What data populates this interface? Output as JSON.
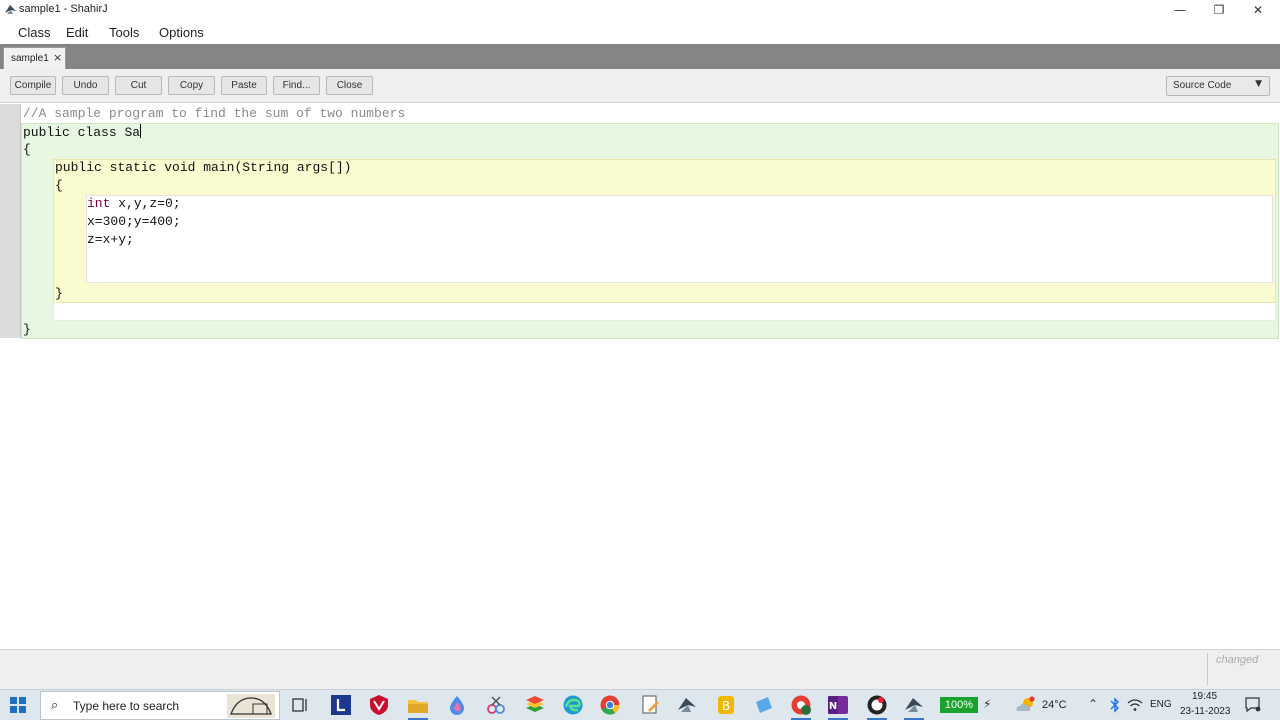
{
  "window": {
    "title": "sample1 - ShahirJ"
  },
  "window_controls": {
    "minimize": "—",
    "maximize": "❐",
    "close": "✕"
  },
  "menu": [
    "Class",
    "Edit",
    "Tools",
    "Options"
  ],
  "tab": {
    "label": "sample1",
    "close": "×"
  },
  "toolbar": {
    "buttons": [
      "Compile",
      "Undo",
      "Cut",
      "Copy",
      "Paste",
      "Find...",
      "Close"
    ],
    "view_select": "Source Code"
  },
  "editor": {
    "comment": "//A sample program to find the sum of two numbers",
    "line_class_kw": "public class",
    "line_class_name": "Sa",
    "open_brace_1": "{",
    "method_kw": "public static void",
    "method_rest": "main(String args[])",
    "open_brace_2": "{",
    "decl_kw": "int",
    "decl_rest": "x,y,z=0;",
    "assign": "x=300;y=400;",
    "sum": "z=x+y;",
    "close_brace_2": "}",
    "close_brace_1": "}"
  },
  "status": {
    "changed": "changed"
  },
  "taskbar": {
    "search_placeholder": "Type here to search",
    "battery": "100%",
    "weather": "24°C",
    "language": "ENG",
    "time": "19:45",
    "date": "23-11-2023",
    "colors": {
      "battery": "#18a42a",
      "taskbar": "#dfe7ee"
    }
  }
}
